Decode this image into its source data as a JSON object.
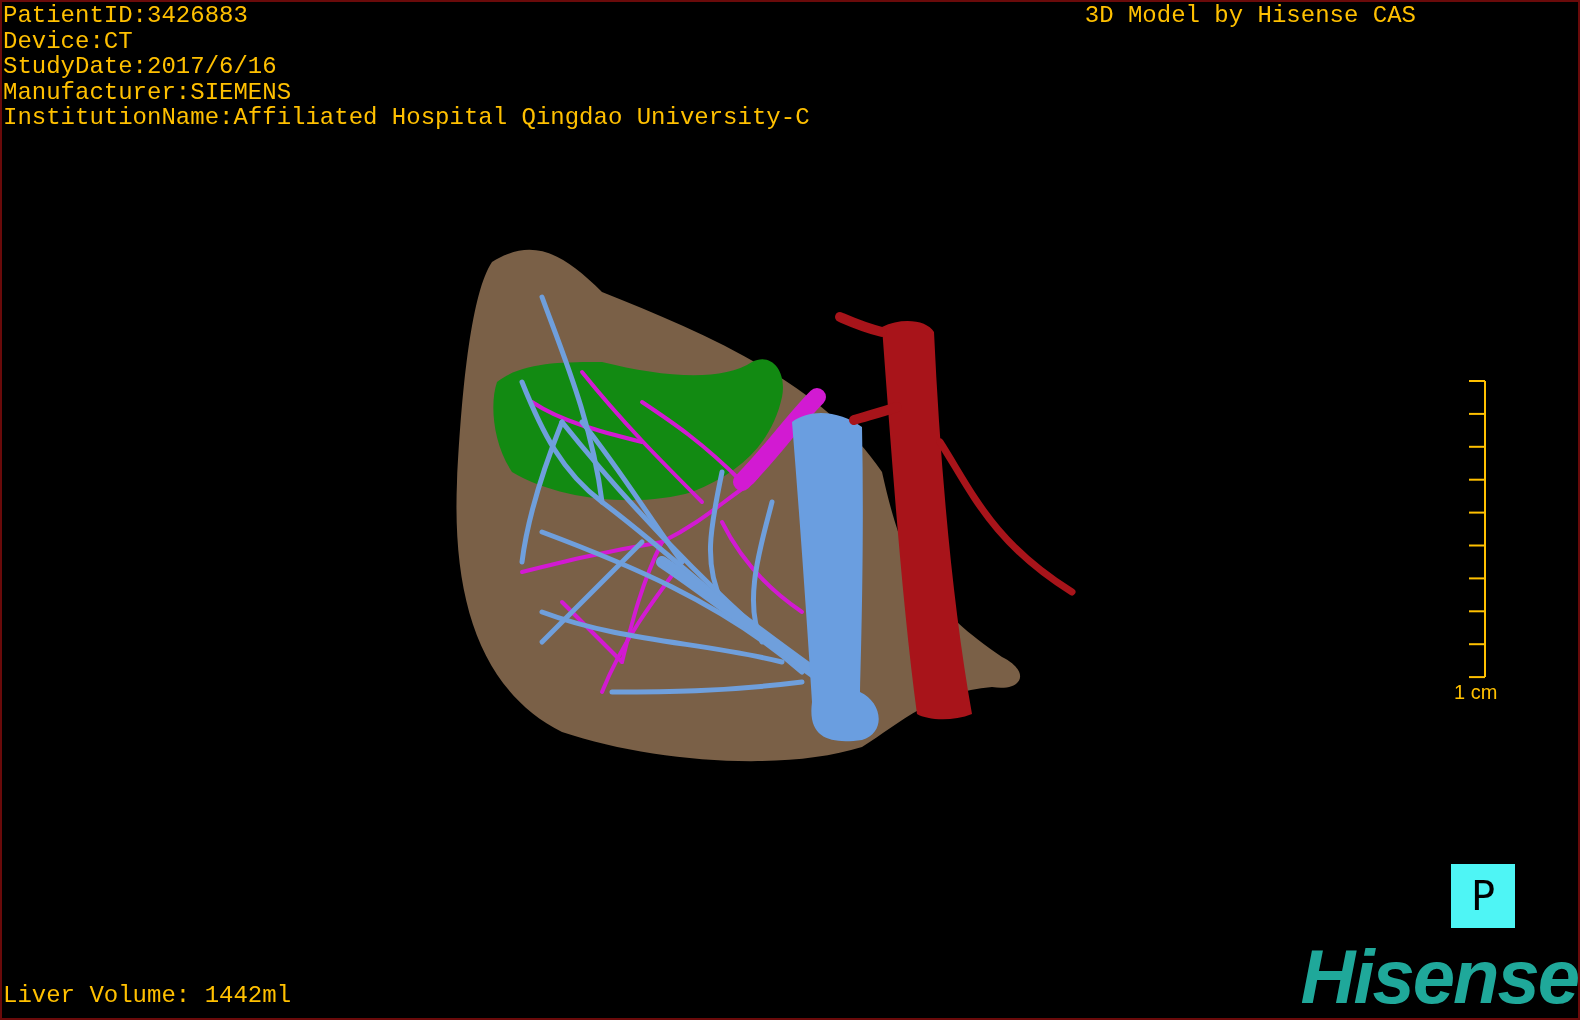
{
  "study_info": [
    "PatientID:3426883",
    "Device:CT",
    "StudyDate:2017/6/16",
    "Manufacturer:SIEMENS",
    "InstitutionName:Affiliated Hospital Qingdao University-C"
  ],
  "model_credit": "3D Model by Hisense CAS",
  "scale_bar": {
    "label": "1 cm"
  },
  "orientation_button": "P",
  "liver_volume": "Liver Volume: 1442ml",
  "logo": "Hisense"
}
